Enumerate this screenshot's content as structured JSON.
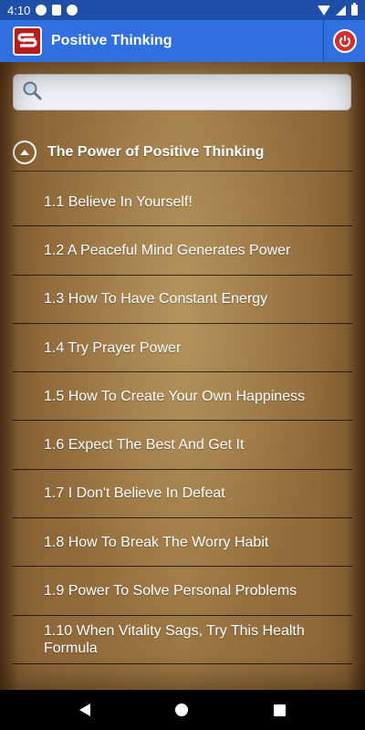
{
  "status_bar": {
    "time": "4:10",
    "icons": [
      "p-icon",
      "sd-card-icon",
      "p-icon",
      "wifi-icon",
      "signal-icon",
      "battery-icon"
    ]
  },
  "app_bar": {
    "title": "Positive Thinking",
    "logo_icon": "app-logo",
    "power_icon": "power-icon",
    "color": "#2f6fe0"
  },
  "search": {
    "value": "",
    "placeholder": ""
  },
  "group": {
    "title": "The Power of Positive Thinking",
    "expanded": true,
    "items": [
      {
        "label": "1.1 Believe In Yourself!"
      },
      {
        "label": "1.2 A Peaceful Mind Generates Power"
      },
      {
        "label": "1.3 How To Have Constant Energy"
      },
      {
        "label": "1.4 Try Prayer Power"
      },
      {
        "label": "1.5 How To Create Your Own Happiness"
      },
      {
        "label": "1.6 Expect The Best And Get It"
      },
      {
        "label": "1.7 I Don't Believe In Defeat"
      },
      {
        "label": "1.8 How To Break The Worry Habit"
      },
      {
        "label": "1.9 Power To Solve Personal Problems"
      },
      {
        "label": "1.10 When Vitality Sags, Try This Health Formula"
      }
    ]
  },
  "nav_bar": {
    "icons": [
      "back-icon",
      "home-icon",
      "recents-icon"
    ]
  }
}
